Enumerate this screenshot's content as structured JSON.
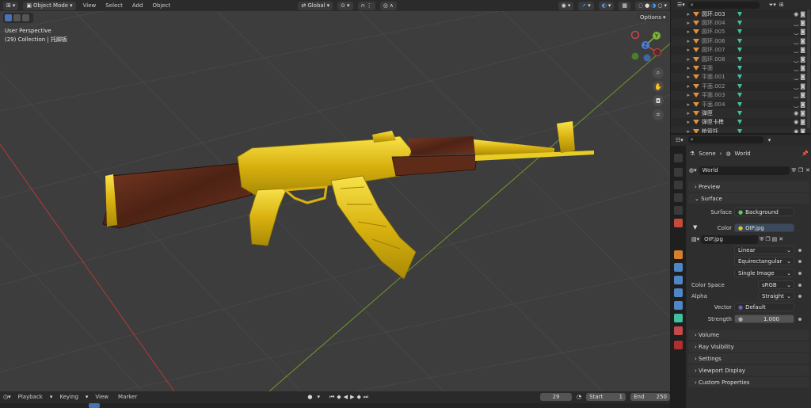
{
  "viewport": {
    "header": {
      "mode": "Object Mode",
      "menus": [
        "View",
        "Select",
        "Add",
        "Object"
      ],
      "orientation": "Global",
      "options": "Options"
    },
    "overlay_line1": "User Perspective",
    "overlay_line2": "(29) Collection | 托脚板",
    "gizmo_axes": {
      "x": "X",
      "y": "Y",
      "z": "Z"
    }
  },
  "timeline": {
    "menus": [
      "Playback",
      "Keying",
      "View",
      "Marker"
    ],
    "current_frame": "29",
    "start_label": "Start",
    "start_value": "1",
    "end_label": "End",
    "end_value": "250"
  },
  "outliner": {
    "items": [
      {
        "name": "圆环.003",
        "active": true
      },
      {
        "name": "圆环.004",
        "active": false
      },
      {
        "name": "圆环.005",
        "active": false
      },
      {
        "name": "圆环.006",
        "active": false
      },
      {
        "name": "圆环.007",
        "active": false
      },
      {
        "name": "圆环.008",
        "active": false
      },
      {
        "name": "平面",
        "active": false
      },
      {
        "name": "平面.001",
        "active": false
      },
      {
        "name": "平面.002",
        "active": false
      },
      {
        "name": "平面.003",
        "active": false
      },
      {
        "name": "平面.004",
        "active": false
      },
      {
        "name": "弹匣",
        "active": true
      },
      {
        "name": "弹匣卡榫",
        "active": true
      },
      {
        "name": "枪管托",
        "active": true
      }
    ]
  },
  "properties": {
    "breadcrumb": {
      "scene": "Scene",
      "world": "World"
    },
    "world_name": "World",
    "sections": {
      "preview": "Preview",
      "surface": "Surface",
      "volume": "Volume",
      "ray_visibility": "Ray Visibility",
      "settings": "Settings",
      "viewport_display": "Viewport Display",
      "custom_properties": "Custom Properties"
    },
    "surface_label": "Surface",
    "surface_value": "Background",
    "color_label": "Color",
    "color_value": "OIP.jpg",
    "image_name": "OIP.jpg",
    "interpolation": "Linear",
    "projection": "Equirectangular",
    "source": "Single Image",
    "color_space_label": "Color Space",
    "color_space_value": "sRGB",
    "alpha_label": "Alpha",
    "alpha_value": "Straight",
    "vector_label": "Vector",
    "vector_value": "Default",
    "strength_label": "Strength",
    "strength_value": "1.000"
  },
  "colors": {
    "accent": "#4772b3",
    "gold": "#e7c418",
    "wood": "#5a2a18",
    "socket_green": "#63c763",
    "socket_blue": "#6363c7"
  }
}
